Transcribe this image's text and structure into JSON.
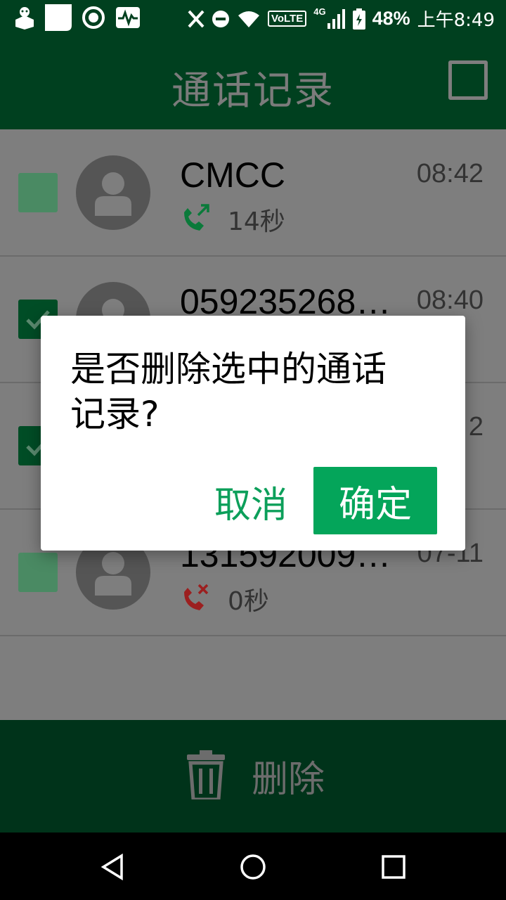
{
  "status_bar": {
    "battery": "48%",
    "time": "上午8:49",
    "network": "4G",
    "volte": "VoLTE"
  },
  "header": {
    "title": "通话记录"
  },
  "calls": [
    {
      "name": "CMCC",
      "time": "08:42",
      "duration": "14秒",
      "type": "outgoing",
      "checked": false
    },
    {
      "name": "059235268…",
      "time": "08:40",
      "duration": "",
      "type": "outgoing",
      "checked": true
    },
    {
      "name": "",
      "time": "2",
      "duration": "",
      "type": "outgoing",
      "checked": true
    },
    {
      "name": "131592009…",
      "time": "07-11",
      "duration": "0秒",
      "type": "missed",
      "checked": false
    }
  ],
  "bottom_bar": {
    "delete_label": "删除"
  },
  "dialog": {
    "message": "是否删除选中的通话记录?",
    "cancel_label": "取消",
    "confirm_label": "确定"
  },
  "colors": {
    "primary_dark": "#00401f",
    "accent": "#04a55a",
    "missed_call": "#c62828",
    "outgoing_call": "#0a7a3a"
  }
}
